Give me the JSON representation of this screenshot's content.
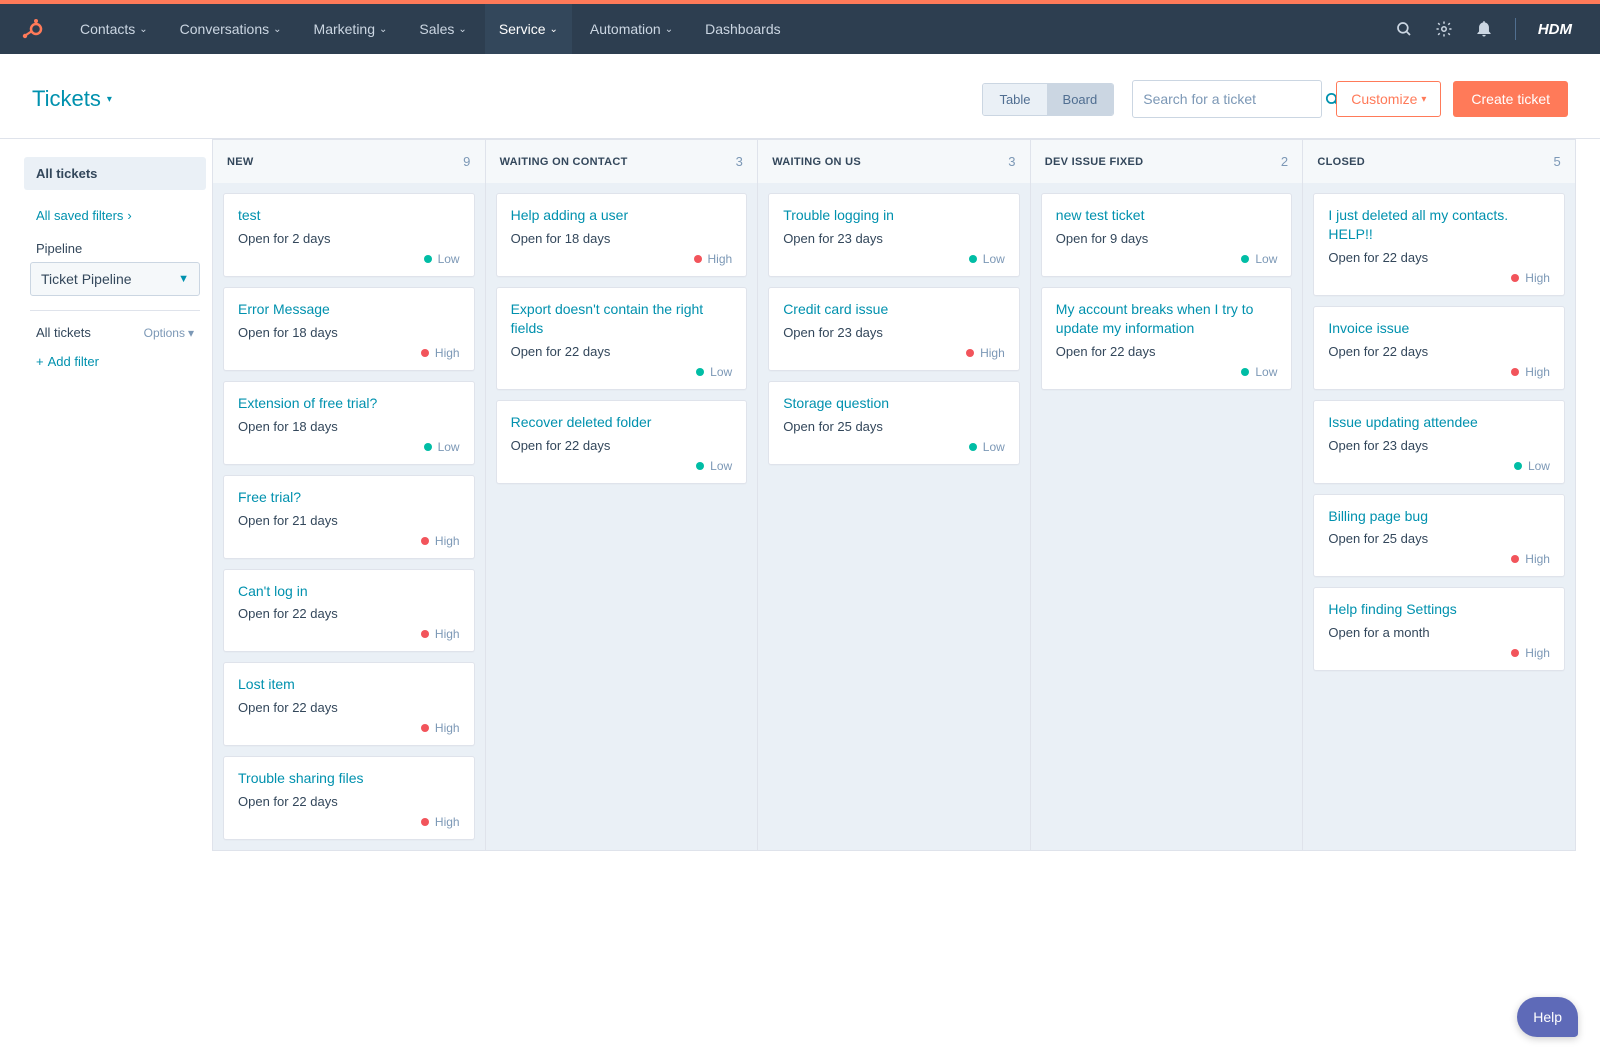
{
  "nav": {
    "items": [
      {
        "label": "Contacts"
      },
      {
        "label": "Conversations"
      },
      {
        "label": "Marketing"
      },
      {
        "label": "Sales"
      },
      {
        "label": "Service"
      },
      {
        "label": "Automation"
      },
      {
        "label": "Dashboards"
      }
    ],
    "active_index": 4,
    "account": "HDM"
  },
  "header": {
    "title": "Tickets",
    "view_table": "Table",
    "view_board": "Board",
    "search_placeholder": "Search for a ticket",
    "customize": "Customize",
    "create": "Create ticket"
  },
  "sidebar": {
    "all_tickets_pill": "All tickets",
    "saved_filters": "All saved filters",
    "pipeline_label": "Pipeline",
    "pipeline_selected": "Ticket Pipeline",
    "all_tickets_row": "All tickets",
    "options": "Options",
    "add_filter": "Add filter"
  },
  "board": {
    "columns": [
      {
        "name": "NEW",
        "count": 9,
        "cards": [
          {
            "title": "test",
            "sub": "Open for 2 days",
            "priority": "Low"
          },
          {
            "title": "Error Message",
            "sub": "Open for 18 days",
            "priority": "High"
          },
          {
            "title": "Extension of free trial?",
            "sub": "Open for 18 days",
            "priority": "Low"
          },
          {
            "title": "Free trial?",
            "sub": "Open for 21 days",
            "priority": "High"
          },
          {
            "title": "Can't log in",
            "sub": "Open for 22 days",
            "priority": "High"
          },
          {
            "title": "Lost item",
            "sub": "Open for 22 days",
            "priority": "High"
          },
          {
            "title": "Trouble sharing files",
            "sub": "Open for 22 days",
            "priority": "High"
          }
        ]
      },
      {
        "name": "WAITING ON CONTACT",
        "count": 3,
        "cards": [
          {
            "title": "Help adding a user",
            "sub": "Open for 18 days",
            "priority": "High"
          },
          {
            "title": "Export doesn't contain the right fields",
            "sub": "Open for 22 days",
            "priority": "Low"
          },
          {
            "title": "Recover deleted folder",
            "sub": "Open for 22 days",
            "priority": "Low"
          }
        ]
      },
      {
        "name": "WAITING ON US",
        "count": 3,
        "cards": [
          {
            "title": "Trouble logging in",
            "sub": "Open for 23 days",
            "priority": "Low"
          },
          {
            "title": "Credit card issue",
            "sub": "Open for 23 days",
            "priority": "High"
          },
          {
            "title": "Storage question",
            "sub": "Open for 25 days",
            "priority": "Low"
          }
        ]
      },
      {
        "name": "DEV ISSUE FIXED",
        "count": 2,
        "cards": [
          {
            "title": "new test ticket",
            "sub": "Open for 9 days",
            "priority": "Low"
          },
          {
            "title": "My account breaks when I try to update my information",
            "sub": "Open for 22 days",
            "priority": "Low"
          }
        ]
      },
      {
        "name": "CLOSED",
        "count": 5,
        "cards": [
          {
            "title": "I just deleted all my contacts. HELP!!",
            "sub": "Open for 22 days",
            "priority": "High"
          },
          {
            "title": "Invoice issue",
            "sub": "Open for 22 days",
            "priority": "High"
          },
          {
            "title": "Issue updating attendee",
            "sub": "Open for 23 days",
            "priority": "Low"
          },
          {
            "title": "Billing page bug",
            "sub": "Open for 25 days",
            "priority": "High"
          },
          {
            "title": "Help finding Settings",
            "sub": "Open for a month",
            "priority": "High"
          }
        ]
      }
    ]
  },
  "help": "Help"
}
